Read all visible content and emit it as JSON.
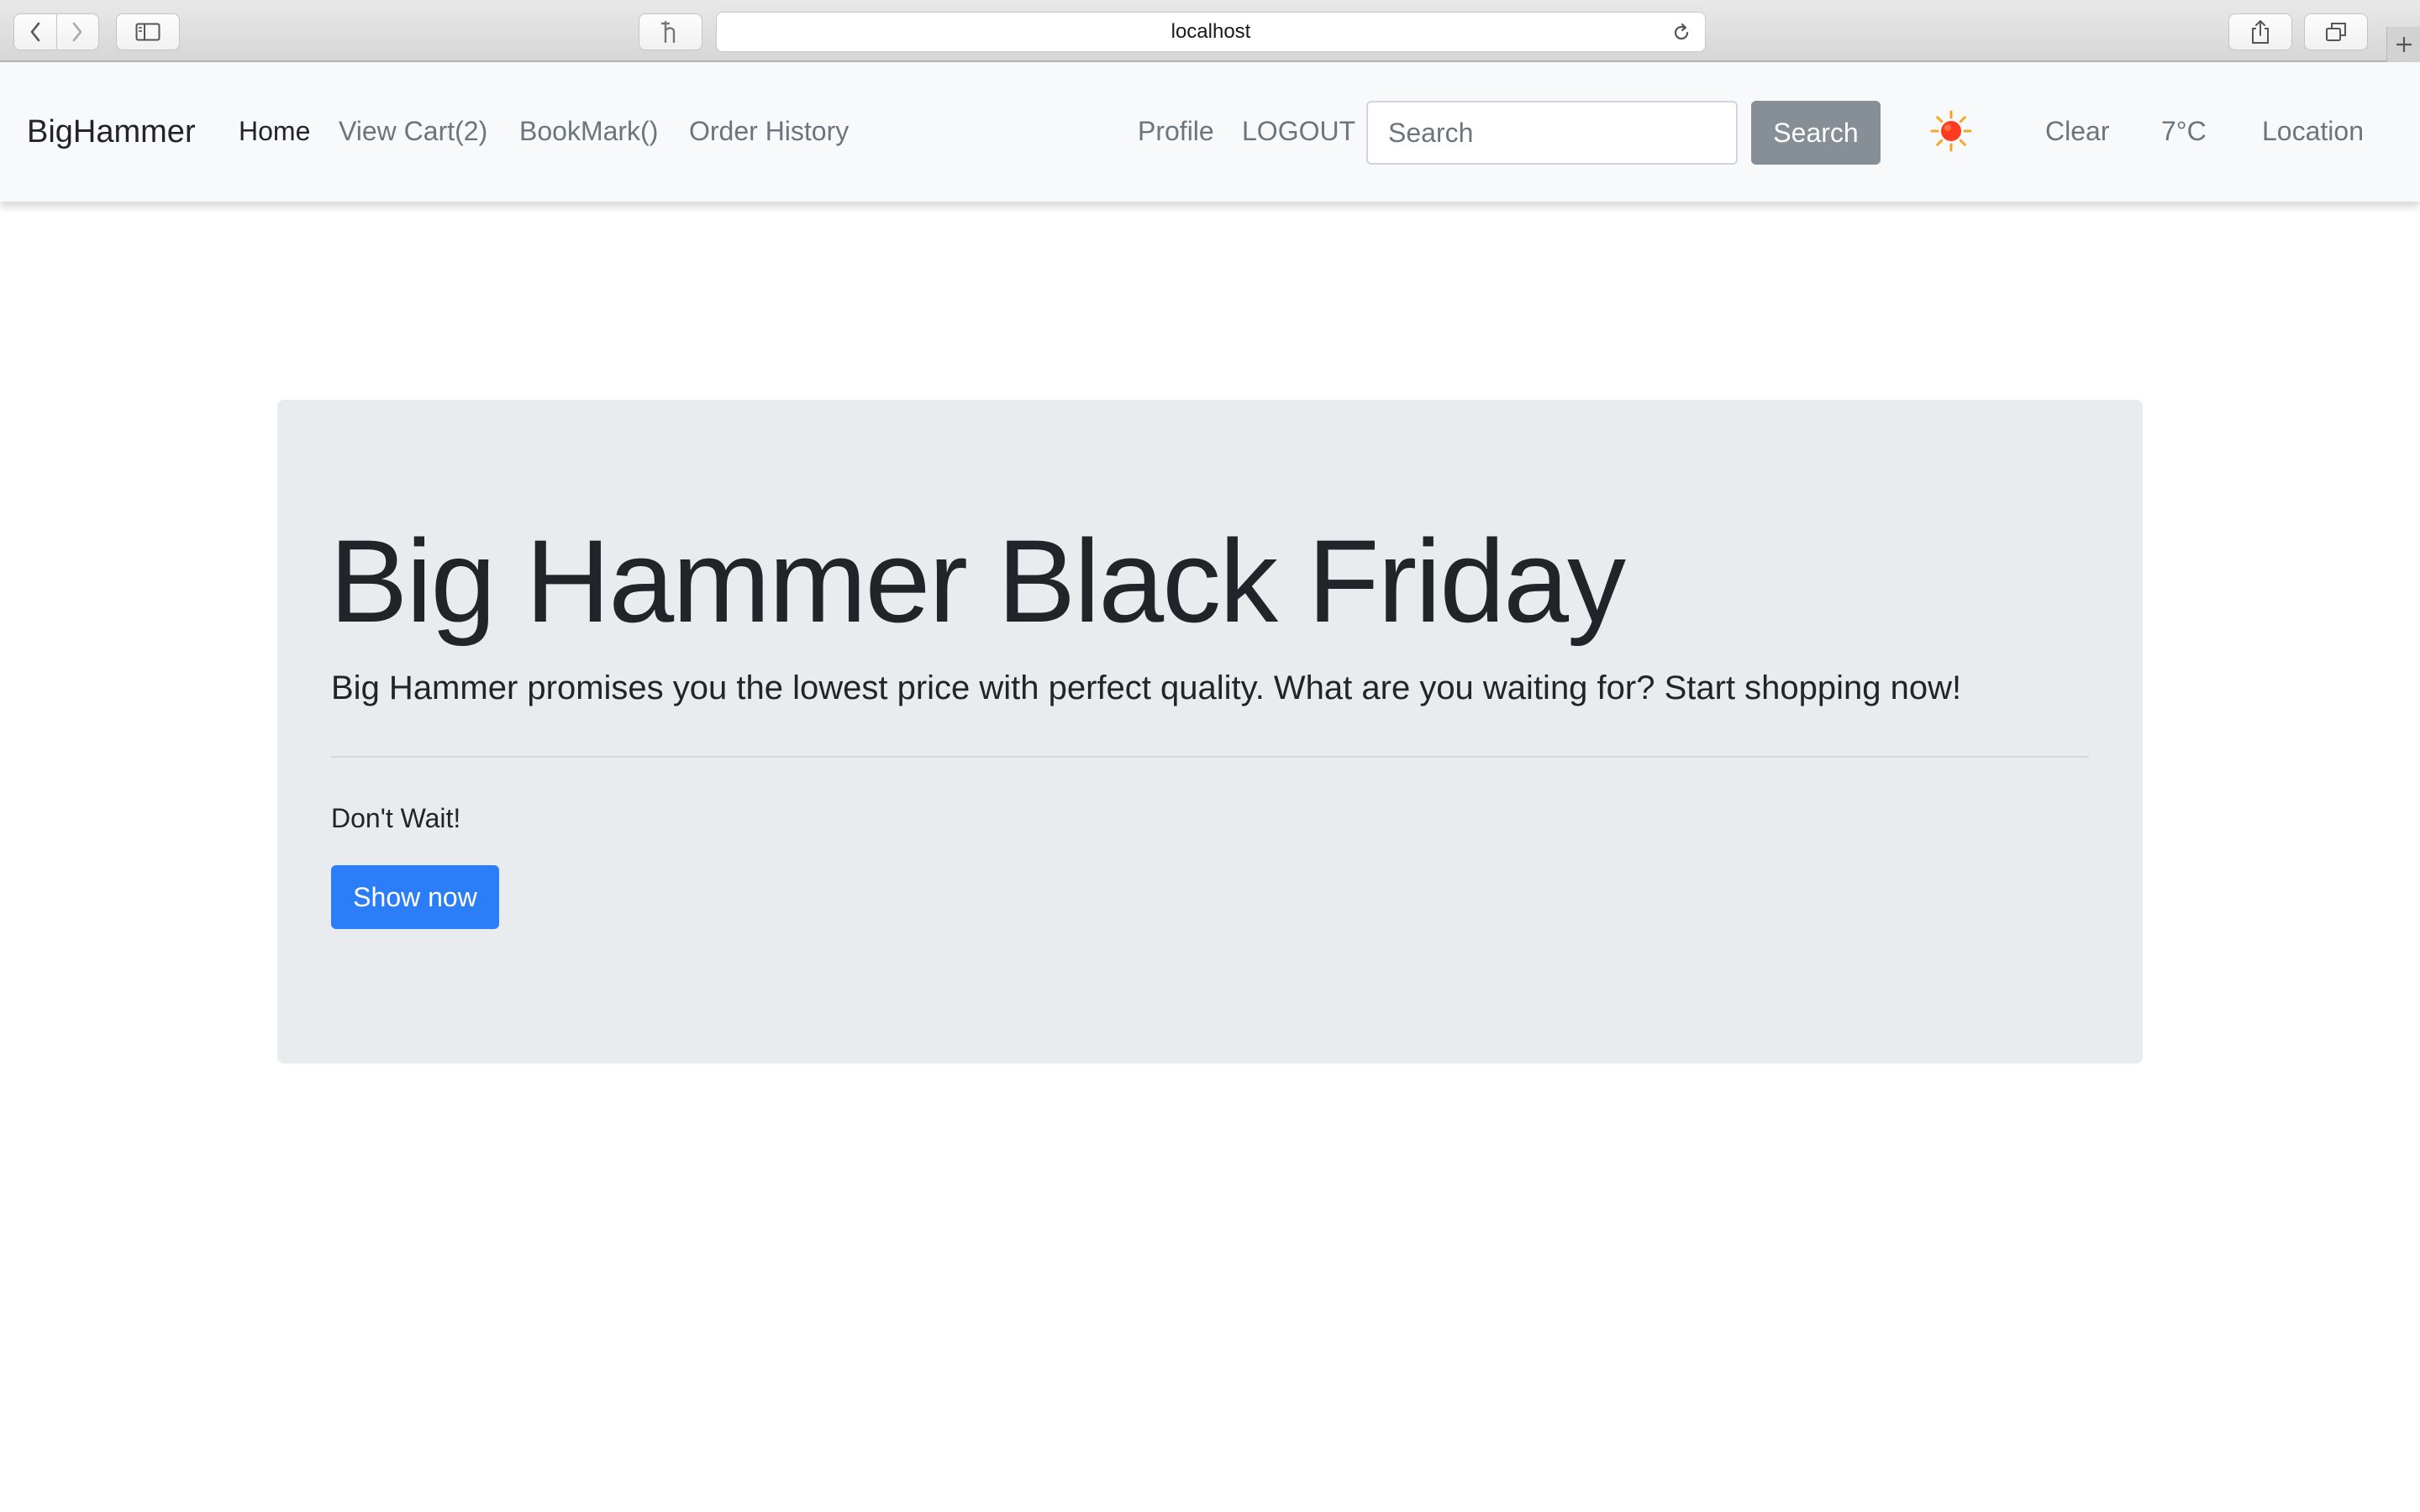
{
  "browser": {
    "url": "localhost"
  },
  "navbar": {
    "brand": "BigHammer",
    "links": [
      {
        "label": "Home",
        "active": true
      },
      {
        "label": "View Cart(2)"
      },
      {
        "label": "BookMark()"
      },
      {
        "label": "Order History"
      }
    ],
    "right_links": {
      "profile": "Profile",
      "logout": "LOGOUT"
    },
    "search": {
      "placeholder": "Search",
      "value": "",
      "button_label": "Search"
    },
    "weather": {
      "icon": "sun-icon",
      "condition": "Clear",
      "temperature": "7°C",
      "location_label": "Location"
    }
  },
  "jumbotron": {
    "title": "Big Hammer Black Friday",
    "lead": "Big Hammer promises you the lowest price with perfect quality. What are you waiting for? Start shopping now!",
    "subtext": "Don't Wait!",
    "button_label": "Show now"
  },
  "colors": {
    "primary": "#2c7ef8",
    "secondary_button": "#868e96",
    "navbar_bg": "#f8f9fa",
    "jumbotron_bg": "#e9ecef",
    "sun": "#ff3b1f"
  }
}
